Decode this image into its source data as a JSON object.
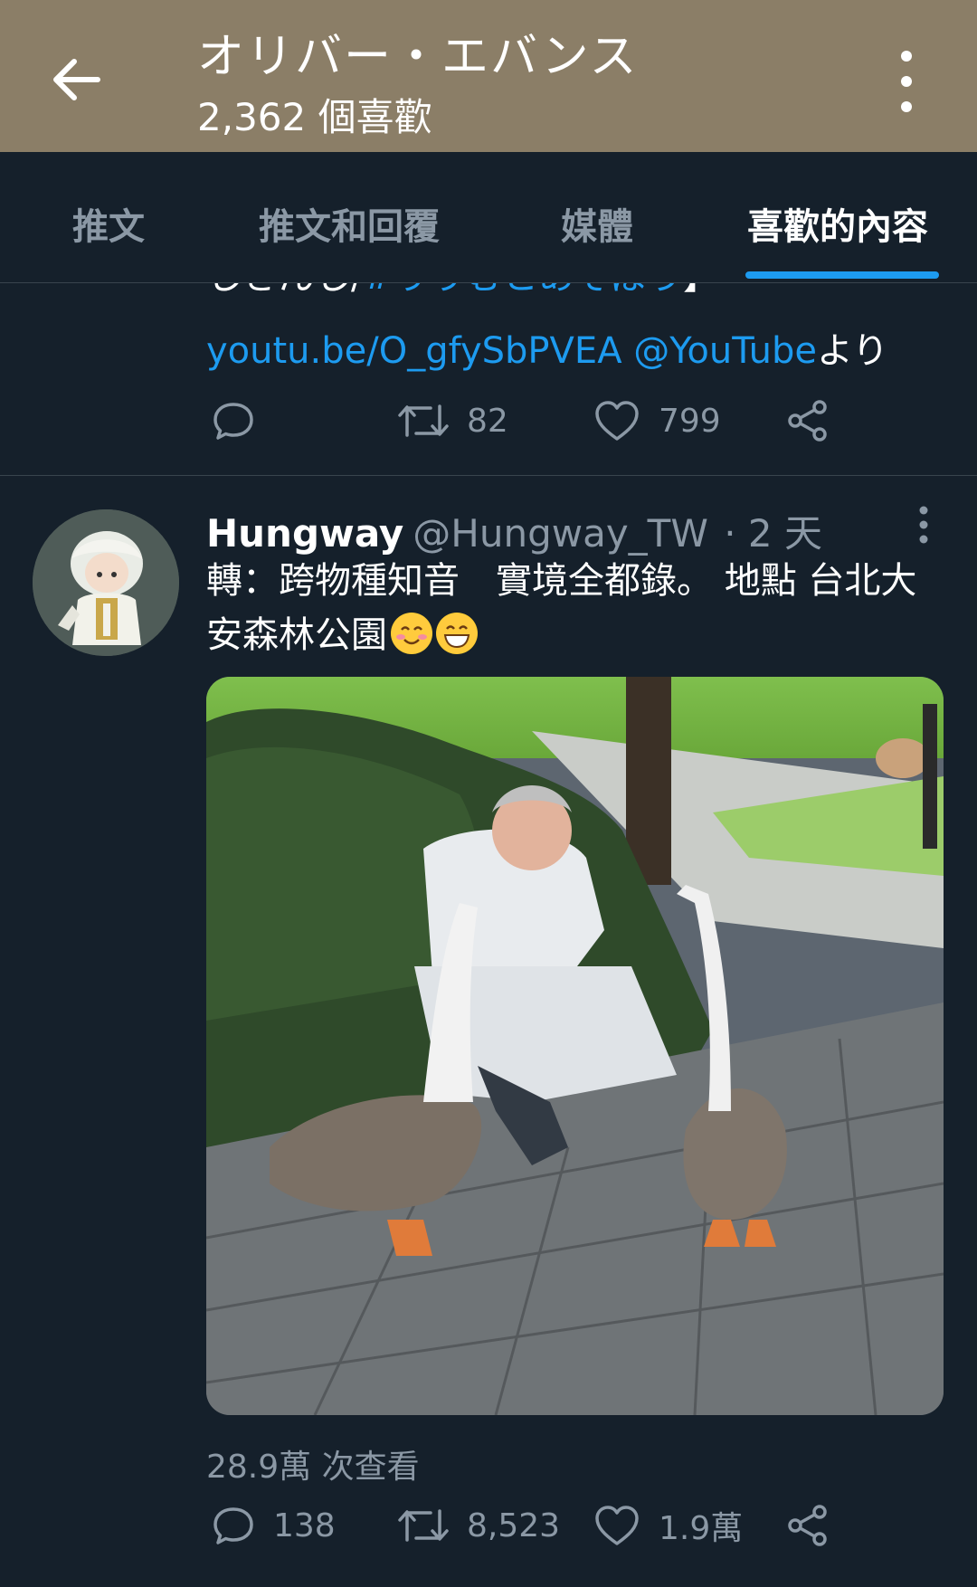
{
  "header": {
    "title": "オリバー・エバンス",
    "subtitle": "2,362 個喜歡",
    "back_icon": "arrow-left-icon",
    "more_icon": "more-vertical-icon",
    "background": "#8b7e67"
  },
  "tabs": [
    {
      "label": "推文",
      "active": false
    },
    {
      "label": "推文和回覆",
      "active": false
    },
    {
      "label": "媒體",
      "active": false
    },
    {
      "label": "喜歡的內容",
      "active": true
    }
  ],
  "tweet1": {
    "cut_text": "しさんし/",
    "cut_hashtag": "#りりむとあそぼう",
    "cut_bracket": "】",
    "link": "youtu.be/O_gfySbPVEA",
    "mention": "@YouTube",
    "suffix": "より",
    "replies": "",
    "retweets": "82",
    "likes": "799"
  },
  "tweet2": {
    "name": "Hungway",
    "handle": "@Hungway_TW",
    "time": "· 2 天",
    "text": "轉：跨物種知音　實境全都錄。 地點 台北大安森林公園",
    "emojis": [
      "smiling-face-with-smiling-eyes",
      "beaming-face-with-smiling-eyes"
    ],
    "views": "28.9萬 次查看",
    "replies": "138",
    "retweets": "8,523",
    "likes": "1.9萬"
  },
  "colors": {
    "background": "#15202b",
    "accent": "#1d9bf0",
    "secondary_text": "#8b98a5",
    "divider": "#38444d"
  }
}
